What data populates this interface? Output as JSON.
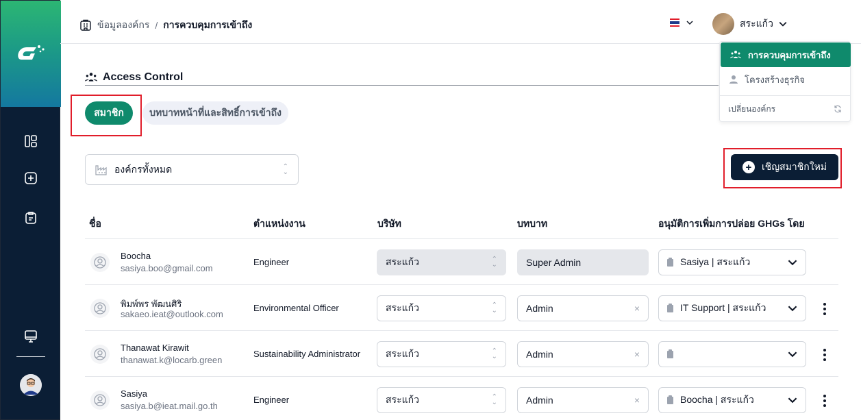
{
  "breadcrumb": {
    "parent": "ข้อมูลองค์กร",
    "separator": "/",
    "current": "การควบคุมการเข้าถึง"
  },
  "header": {
    "user_name": "สระแก้ว",
    "flag_colors": [
      "#e11d2a",
      "#ffffff",
      "#1e3a8a",
      "#ffffff",
      "#e11d2a"
    ]
  },
  "menu": {
    "items": [
      {
        "label": "การควบคุมการเข้าถึง",
        "active": true,
        "icon": "access-control-icon"
      },
      {
        "label": "โครงสร้างธุรกิจ",
        "active": false,
        "icon": "person-icon"
      }
    ],
    "switch_org_label": "เปลี่ยนองค์กร"
  },
  "page": {
    "title": "Access Control",
    "tabs": [
      {
        "label": "สมาชิก",
        "active": true
      },
      {
        "label": "บทบาทหน้าที่และสิทธิ์การเข้าถึง",
        "active": false
      }
    ],
    "org_filter": "องค์กรทั้งหมด",
    "invite_button": "เชิญสมาชิกใหม่"
  },
  "table": {
    "headers": {
      "name": "ชื่อ",
      "position": "ตำแหน่งงาน",
      "company": "บริษัท",
      "role": "บทบาท",
      "approver": "อนุมัติการเพิ่มการปล่อย GHGs โดย"
    },
    "rows": [
      {
        "name": "Boocha",
        "email": "sasiya.boo@gmail.com",
        "position": "Engineer",
        "company": "สระแก้ว",
        "role": "Super Admin",
        "approver": "Sasiya | สระแก้ว",
        "locked": true
      },
      {
        "name": "พิมพ์พร พัฒนศิริ",
        "email": "sakaeo.ieat@outlook.com",
        "position": "Environmental Officer",
        "company": "สระแก้ว",
        "role": "Admin",
        "approver": "IT Support | สระแก้ว",
        "locked": false
      },
      {
        "name": "Thanawat Kirawit",
        "email": "thanawat.k@locarb.green",
        "position": "Sustainability Administrator",
        "company": "สระแก้ว",
        "role": "Admin",
        "approver": "",
        "locked": false
      },
      {
        "name": "Sasiya",
        "email": "sasiya.b@ieat.mail.go.th",
        "position": "Engineer",
        "company": "สระแก้ว",
        "role": "Admin",
        "approver": "Boocha | สระแก้ว",
        "locked": false
      }
    ]
  },
  "colors": {
    "brand_green": "#0f8a6c",
    "navy": "#0b1e35",
    "highlight_red": "#e11d2a"
  }
}
